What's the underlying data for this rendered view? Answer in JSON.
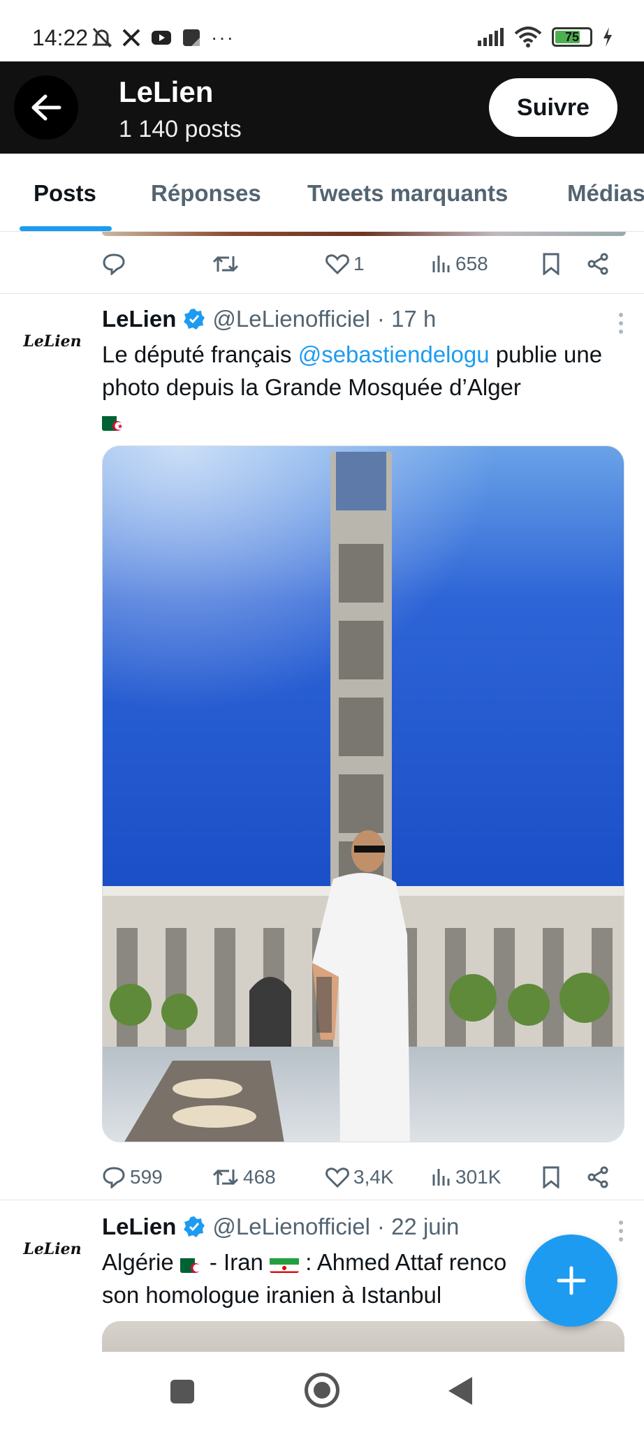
{
  "status_bar": {
    "time": "14:22",
    "battery": "75",
    "battery_level": 0.75,
    "icons_left": [
      "mute-bell-icon",
      "x-logo-icon",
      "youtube-icon",
      "app-icon",
      "more-dots-icon"
    ],
    "icons_right": [
      "signal-icon",
      "wifi-icon",
      "battery-icon",
      "charging-icon"
    ]
  },
  "header": {
    "title": "LeLien",
    "subtitle": "1 140 posts",
    "follow_label": "Suivre"
  },
  "tabs": [
    {
      "label": "Posts",
      "active": true
    },
    {
      "label": "Réponses",
      "active": false
    },
    {
      "label": "Tweets marquants",
      "active": false
    },
    {
      "label": "Médias",
      "active": false
    }
  ],
  "prev_tweet": {
    "likes": "1",
    "views": "658"
  },
  "tweet1": {
    "avatar_text": "LeLien",
    "name": "LeLien",
    "handle": "@LeLienofficiel",
    "time": "· 17 h",
    "text_before": "Le député français ",
    "mention": "@sebastiendelogu",
    "text_after": " publie une photo depuis la Grande Mosquée d’Alger",
    "replies": "599",
    "retweets": "468",
    "likes": "3,4K",
    "views": "301K"
  },
  "tweet2": {
    "avatar_text": "LeLien",
    "name": "LeLien",
    "handle": "@LeLienofficiel",
    "time": "· 22 juin",
    "text_part1": "Algérie ",
    "text_part2": "- Iran ",
    "text_part3": " : Ahmed Attaf renco",
    "text_line2": "son homologue iranien à Istanbul"
  },
  "colors": {
    "accent": "#1d9bf0",
    "header_bg": "#111111",
    "muted": "#536471"
  }
}
